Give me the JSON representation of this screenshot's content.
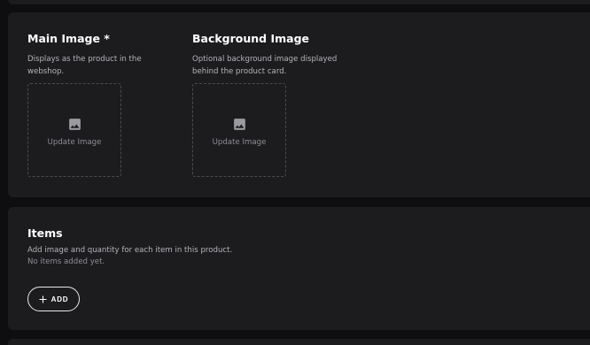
{
  "main_image": {
    "title": "Main Image *",
    "description": "Displays as the product in the webshop.",
    "dropzone_label": "Update Image",
    "icon": "image-icon"
  },
  "background_image": {
    "title": "Background Image",
    "description": "Optional background image displayed behind the product card.",
    "dropzone_label": "Update Image",
    "icon": "image-icon"
  },
  "items": {
    "title": "Items",
    "description": "Add image and quantity for each item in this product.",
    "empty_text": "No items added yet.",
    "add_label": "ADD",
    "add_icon": "plus-icon"
  },
  "colors": {
    "page_bg": "#0e0e10",
    "card_bg": "#1c1c1f",
    "text_primary": "#ffffff",
    "text_secondary": "#b4b4b9",
    "text_muted": "#8e8e94",
    "dashed_border": "#4a4a50"
  }
}
